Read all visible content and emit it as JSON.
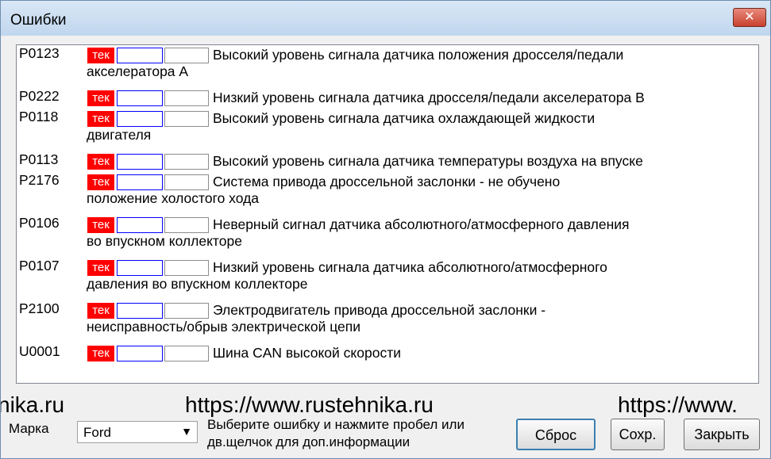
{
  "window": {
    "title": "Ошибки",
    "close_glyph": "✕"
  },
  "errors": {
    "status_label": "тек",
    "items": [
      {
        "code": "P0123",
        "description": "Высокий уровень сигнала датчика положения дросселя/педали акселератора А"
      },
      {
        "code": "P0222",
        "description": "Низкий уровень сигнала датчика дросселя/педали акселератора В"
      },
      {
        "code": "P0118",
        "description": "Высокий уровень сигнала датчика охлаждающей жидкости двигателя"
      },
      {
        "code": "P0113",
        "description": "Высокий уровень сигнала датчика температуры воздуха на впуске"
      },
      {
        "code": "P2176",
        "description": "Система привода дроссельной заслонки - не обучено положение холостого хода"
      },
      {
        "code": "P0106",
        "description": "Неверный сигнал датчика абсолютного/атмосферного давления во впускном коллекторе"
      },
      {
        "code": "P0107",
        "description": "Низкий уровень сигнала датчика абсолютного/атмосферного давления во впускном коллекторе"
      },
      {
        "code": "P2100",
        "description": "Электродвигатель привода дроссельной заслонки - неисправность/обрыв электрической цепи"
      },
      {
        "code": "U0001",
        "description": "Шина CAN высокой скорости"
      }
    ]
  },
  "footer": {
    "brand_label": "Марка",
    "brand_value": "Ford",
    "hint": "Выберите ошибку и нажмите пробел или дв.щелчок для доп.информации",
    "reset_button": "Сброс",
    "save_button": "Сохр.",
    "close_button": "Закрыть"
  },
  "watermark": {
    "left": "nika.ru",
    "center": "https://www.rustehnika.ru",
    "right": "https://www."
  }
}
